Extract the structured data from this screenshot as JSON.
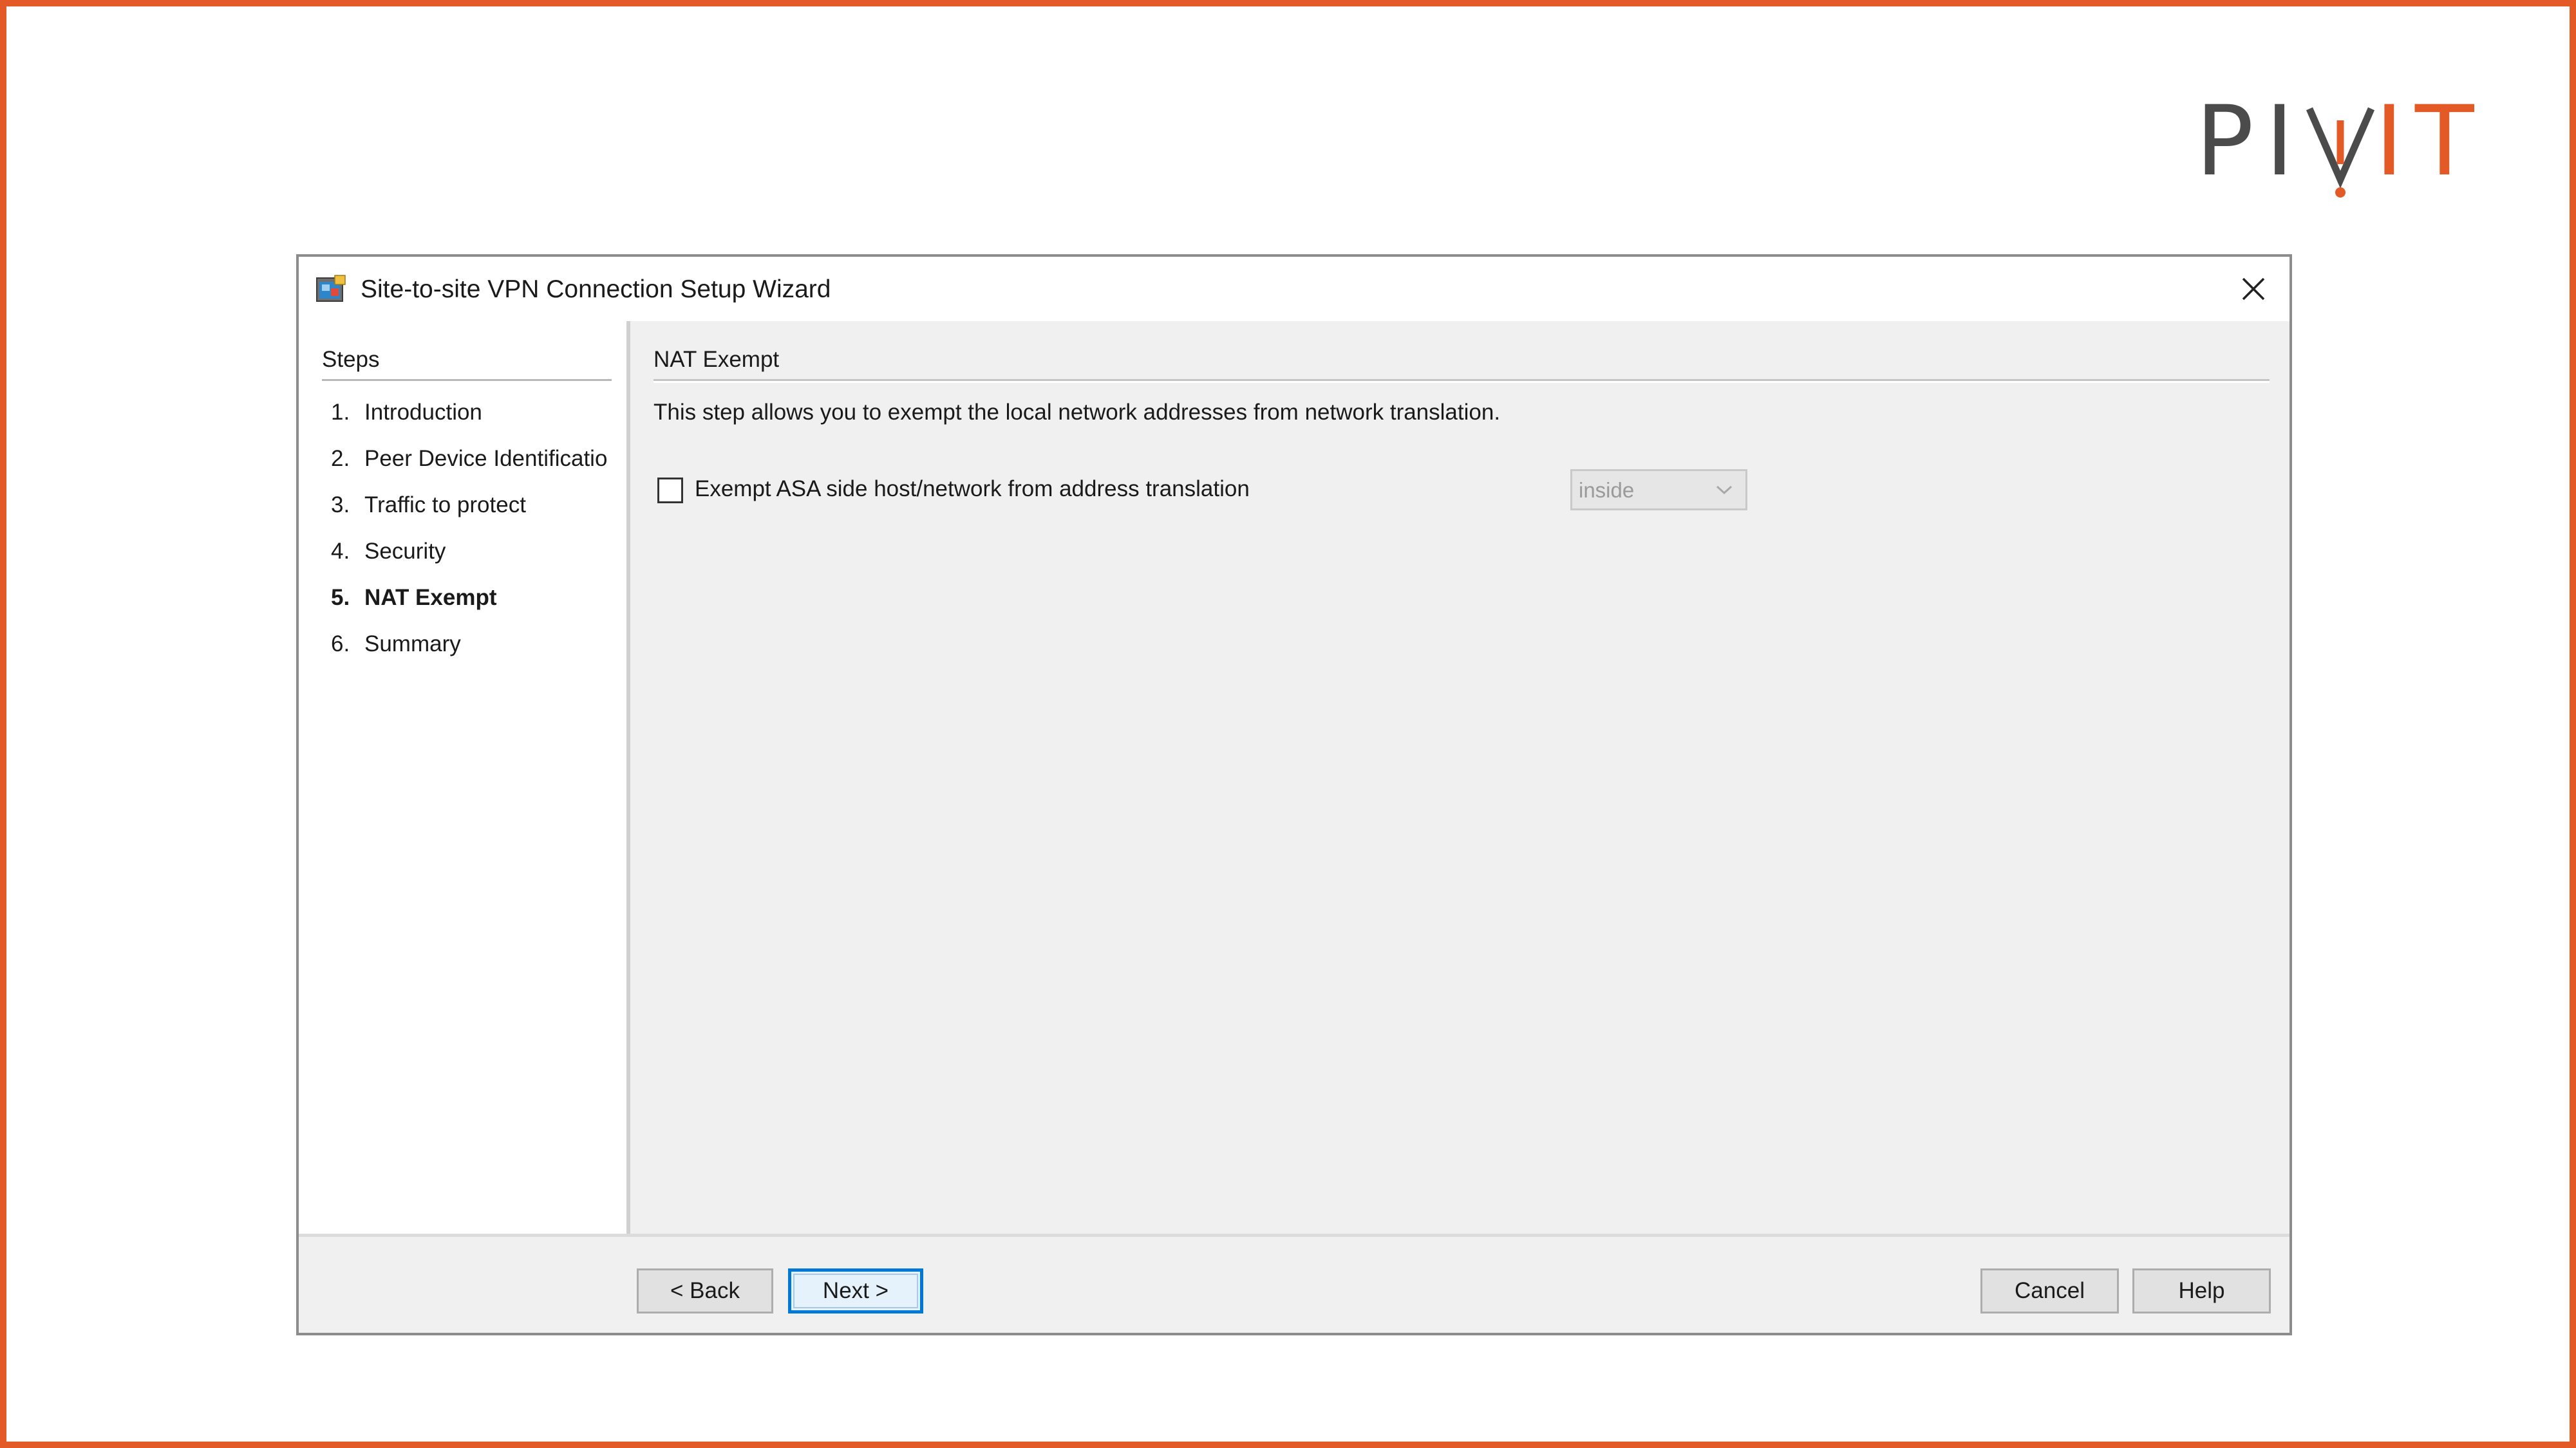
{
  "brand": {
    "logo_text": "PIVIT",
    "accent_color": "#e35a26",
    "frame_color": "#e35a26"
  },
  "window": {
    "title": "Site-to-site VPN Connection Setup Wizard",
    "icon": "wizard-app-icon",
    "close_icon": "close-icon"
  },
  "steps": {
    "header": "Steps",
    "items": [
      {
        "num": "1.",
        "label": "Introduction",
        "active": false
      },
      {
        "num": "2.",
        "label": "Peer Device Identificatio",
        "active": false
      },
      {
        "num": "3.",
        "label": "Traffic to protect",
        "active": false
      },
      {
        "num": "4.",
        "label": "Security",
        "active": false
      },
      {
        "num": "5.",
        "label": "NAT Exempt",
        "active": true
      },
      {
        "num": "6.",
        "label": "Summary",
        "active": false
      }
    ]
  },
  "content": {
    "section_title": "NAT Exempt",
    "description": "This step allows you to exempt the local network addresses from network translation.",
    "exempt_checkbox": {
      "label": "Exempt ASA side host/network from address translation",
      "checked": false
    },
    "interface_select": {
      "value": "inside",
      "enabled": false
    }
  },
  "footer": {
    "back_label": "< Back",
    "next_label": "Next >",
    "cancel_label": "Cancel",
    "help_label": "Help"
  }
}
